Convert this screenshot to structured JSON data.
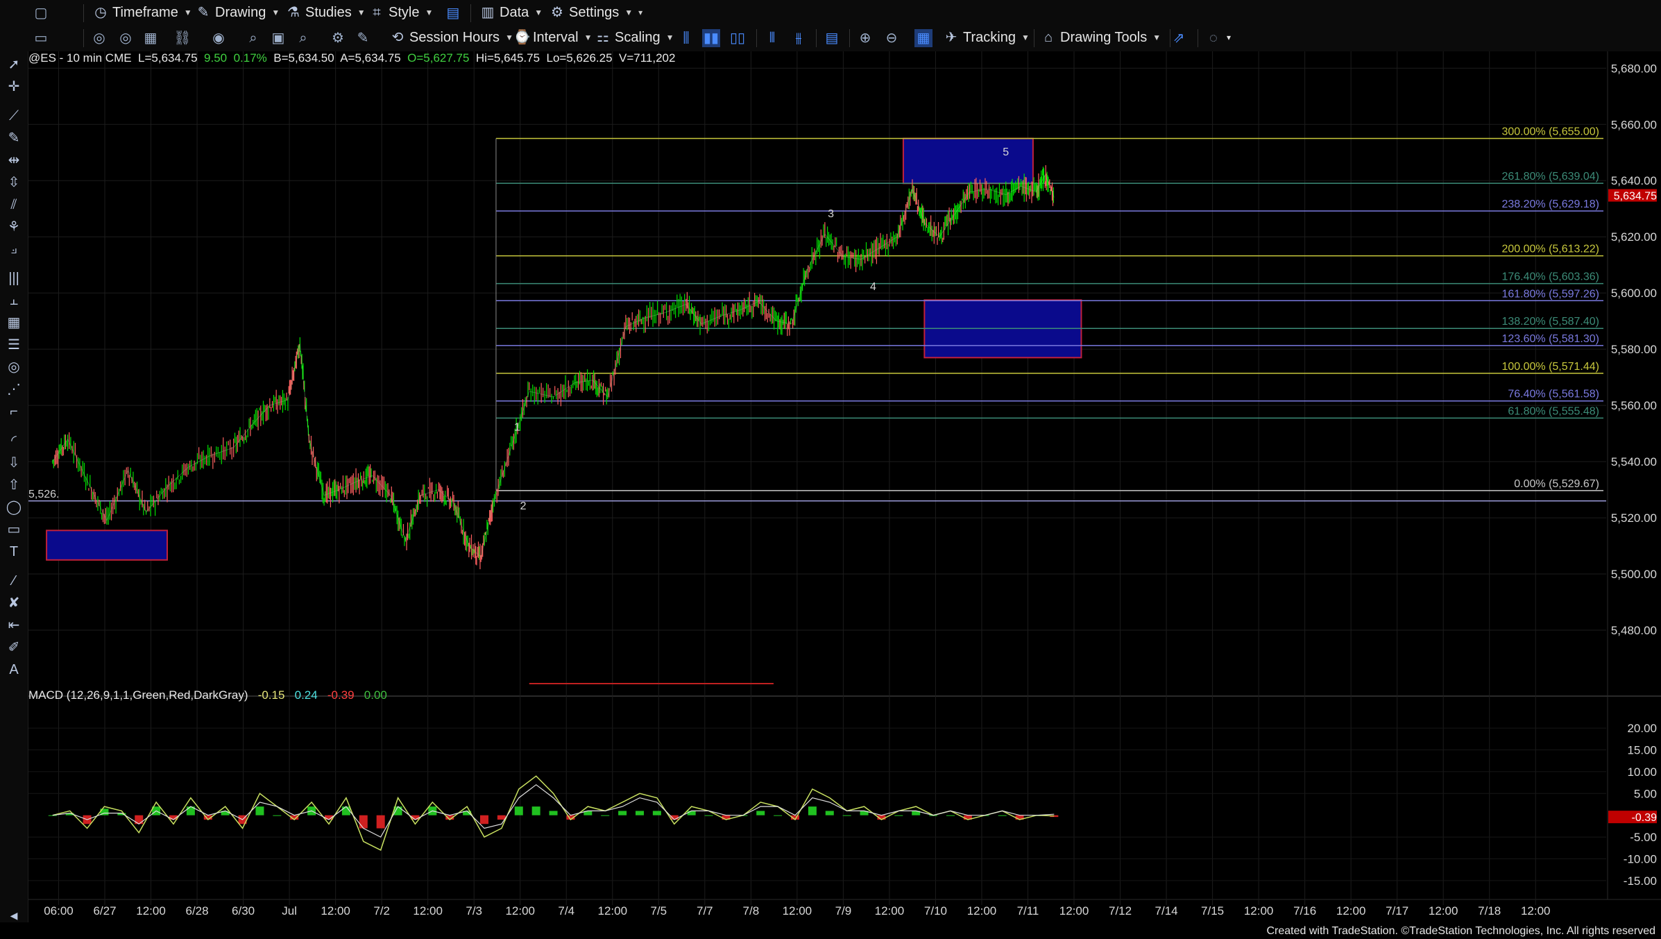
{
  "toolbar_top": {
    "items": [
      {
        "label": "Timeframe",
        "icon": "clock-icon"
      },
      {
        "label": "Drawing",
        "icon": "pen-icon"
      },
      {
        "label": "Studies",
        "icon": "flask-icon"
      },
      {
        "label": "Style",
        "icon": "style-icon"
      },
      {
        "label": "Data",
        "icon": "data-icon"
      },
      {
        "label": "Settings",
        "icon": "gear-icon"
      }
    ]
  },
  "toolbar_second": {
    "items": [
      {
        "label": "Session Hours",
        "icon": "session-icon"
      },
      {
        "label": "Interval",
        "icon": "interval-icon"
      },
      {
        "label": "Scaling",
        "icon": "scaling-icon"
      },
      {
        "label": "Tracking",
        "icon": "tracking-icon"
      },
      {
        "label": "Drawing Tools",
        "icon": "drawing-tools-icon"
      }
    ]
  },
  "symbol_header": {
    "symbol": "@ES - 10 min  CME",
    "last": "L=5,634.75",
    "change": "9.50",
    "pct": "0.17%",
    "bid": "B=5,634.50",
    "ask": "A=5,634.75",
    "open": "O=5,627.75",
    "high": "Hi=5,645.75",
    "low": "Lo=5,626.25",
    "volume": "V=711,202"
  },
  "macd_header": {
    "name": "MACD (12,26,9,1,1,Green,Red,DarkGray)",
    "v1": "-0.15",
    "v2": "0.24",
    "v3": "-0.39",
    "v4": "0.00"
  },
  "footer": "Created with TradeStation. ©TradeStation Technologies, Inc. All rights reserved",
  "colors": {
    "fib_yellow": "#c8c83c",
    "fib_teal": "#3c8c78",
    "fib_purple": "#7a7ae0",
    "box_fill": "#0a0a8c",
    "box_border": "#c0203c",
    "candle_up": "#00e000",
    "candle_down": "#ff6060",
    "macd_fast": "#c8e060",
    "macd_slow": "#e0e0e0",
    "last_price_tag": "#c00000"
  },
  "chart_data": [
    {
      "type": "line",
      "title": "@ES - 10 min  CME",
      "y_axis_ticks": [
        "5,680.00",
        "5,660.00",
        "5,640.00",
        "5,620.00",
        "5,600.00",
        "5,580.00",
        "5,560.00",
        "5,540.00",
        "5,520.00",
        "5,500.00",
        "5,480.00"
      ],
      "ylim": [
        5460,
        5686
      ],
      "x_axis_ticks": [
        "06:00",
        "6/27",
        "12:00",
        "6/28",
        "6/30",
        "Jul",
        "12:00",
        "7/2",
        "12:00",
        "7/3",
        "12:00",
        "7/4",
        "12:00",
        "7/5",
        "7/7",
        "7/8",
        "12:00",
        "7/9",
        "12:00",
        "7/10",
        "12:00",
        "7/11",
        "12:00",
        "7/12",
        "7/14",
        "7/15",
        "12:00",
        "7/16",
        "12:00",
        "7/17",
        "12:00",
        "7/18",
        "12:00"
      ],
      "last_price_label": "5,634.75",
      "last_price": 5634.75,
      "price_path": [
        {
          "t": 0.0,
          "p": 5540
        },
        {
          "t": 0.5,
          "p": 5548
        },
        {
          "t": 1.2,
          "p": 5532
        },
        {
          "t": 1.8,
          "p": 5519
        },
        {
          "t": 2.5,
          "p": 5537
        },
        {
          "t": 3.1,
          "p": 5522
        },
        {
          "t": 3.8,
          "p": 5531
        },
        {
          "t": 4.5,
          "p": 5538
        },
        {
          "t": 5.2,
          "p": 5542
        },
        {
          "t": 6.0,
          "p": 5545
        },
        {
          "t": 6.6,
          "p": 5553
        },
        {
          "t": 7.2,
          "p": 5560
        },
        {
          "t": 7.8,
          "p": 5562
        },
        {
          "t": 8.2,
          "p": 5582
        },
        {
          "t": 8.5,
          "p": 5548
        },
        {
          "t": 9.0,
          "p": 5528
        },
        {
          "t": 9.5,
          "p": 5530
        },
        {
          "t": 10.1,
          "p": 5533
        },
        {
          "t": 10.6,
          "p": 5535
        },
        {
          "t": 11.2,
          "p": 5528
        },
        {
          "t": 11.7,
          "p": 5512
        },
        {
          "t": 12.2,
          "p": 5528
        },
        {
          "t": 12.8,
          "p": 5530
        },
        {
          "t": 13.3,
          "p": 5525
        },
        {
          "t": 13.8,
          "p": 5510
        },
        {
          "t": 14.2,
          "p": 5506
        },
        {
          "t": 14.6,
          "p": 5525
        },
        {
          "t": 15.2,
          "p": 5545
        },
        {
          "t": 15.8,
          "p": 5565
        },
        {
          "t": 16.6,
          "p": 5563
        },
        {
          "t": 17.3,
          "p": 5568
        },
        {
          "t": 17.9,
          "p": 5569
        },
        {
          "t": 18.4,
          "p": 5563
        },
        {
          "t": 19.0,
          "p": 5588
        },
        {
          "t": 19.6,
          "p": 5591
        },
        {
          "t": 20.3,
          "p": 5593
        },
        {
          "t": 21.0,
          "p": 5596
        },
        {
          "t": 21.5,
          "p": 5589
        },
        {
          "t": 22.2,
          "p": 5592
        },
        {
          "t": 22.8,
          "p": 5594
        },
        {
          "t": 23.4,
          "p": 5597
        },
        {
          "t": 24.0,
          "p": 5590
        },
        {
          "t": 24.5,
          "p": 5589
        },
        {
          "t": 25.0,
          "p": 5608
        },
        {
          "t": 25.6,
          "p": 5621
        },
        {
          "t": 26.2,
          "p": 5613
        },
        {
          "t": 26.8,
          "p": 5612
        },
        {
          "t": 27.4,
          "p": 5616
        },
        {
          "t": 28.0,
          "p": 5620
        },
        {
          "t": 28.5,
          "p": 5637
        },
        {
          "t": 28.9,
          "p": 5625
        },
        {
          "t": 29.4,
          "p": 5620
        },
        {
          "t": 29.9,
          "p": 5628
        },
        {
          "t": 30.4,
          "p": 5636
        },
        {
          "t": 31.0,
          "p": 5637
        },
        {
          "t": 31.6,
          "p": 5635
        },
        {
          "t": 32.1,
          "p": 5638
        },
        {
          "t": 32.6,
          "p": 5636
        },
        {
          "t": 32.9,
          "p": 5642
        },
        {
          "t": 33.2,
          "p": 5634
        }
      ],
      "fib_levels": [
        {
          "label": "300.00% (5,655.00)",
          "price": 5655.0,
          "color": "#c8c83c"
        },
        {
          "label": "261.80% (5,639.04)",
          "price": 5639.04,
          "color": "#3c8c78"
        },
        {
          "label": "238.20% (5,629.18)",
          "price": 5629.18,
          "color": "#7a7ae0"
        },
        {
          "label": "200.00% (5,613.22)",
          "price": 5613.22,
          "color": "#c8c83c"
        },
        {
          "label": "176.40% (5,603.36)",
          "price": 5603.36,
          "color": "#3c8c78"
        },
        {
          "label": "161.80% (5,597.26)",
          "price": 5597.26,
          "color": "#7a7ae0"
        },
        {
          "label": "138.20% (5,587.40)",
          "price": 5587.4,
          "color": "#3c8c78"
        },
        {
          "label": "123.60% (5,581.30)",
          "price": 5581.3,
          "color": "#7a7ae0"
        },
        {
          "label": "100.00% (5,571.44)",
          "price": 5571.44,
          "color": "#c8c83c"
        },
        {
          "label": "76.40% (5,561.58)",
          "price": 5561.58,
          "color": "#7a7ae0"
        },
        {
          "label": "61.80% (5,555.48)",
          "price": 5555.48,
          "color": "#3c8c78"
        },
        {
          "label": "0.00% (5,529.67)",
          "price": 5529.67,
          "color": "#c8c8c8"
        }
      ],
      "horizontal_line": {
        "label": "5,526.",
        "price": 5526.0
      },
      "wave_labels": [
        {
          "label": "1",
          "t": 15.4,
          "p": 5551
        },
        {
          "label": "2",
          "t": 15.6,
          "p": 5523
        },
        {
          "label": "3",
          "t": 25.8,
          "p": 5627
        },
        {
          "label": "4",
          "t": 27.2,
          "p": 5601
        },
        {
          "label": "5",
          "t": 31.6,
          "p": 5649
        }
      ],
      "target_boxes": [
        {
          "t0": 28.2,
          "t1": 32.5,
          "p_top": 5655.0,
          "p_bottom": 5639.0
        },
        {
          "t0": 28.9,
          "t1": 34.1,
          "p_top": 5597.5,
          "p_bottom": 5577.0
        },
        {
          "t0": -0.2,
          "t1": 3.8,
          "p_top": 5515.5,
          "p_bottom": 5505.0
        }
      ]
    },
    {
      "type": "line",
      "title": "MACD (12,26,9,1,1,Green,Red,DarkGray)",
      "y_axis_ticks": [
        "20.00",
        "15.00",
        "10.00",
        "5.00",
        "-5.00",
        "-10.00",
        "-15.00"
      ],
      "ylim": [
        -19,
        24
      ],
      "last_value_label": "-0.39",
      "macd": [
        0,
        1,
        -3,
        2,
        1,
        -4,
        3,
        -2,
        4,
        -1,
        2,
        -3,
        5,
        2,
        -1,
        3,
        -2,
        4,
        -6,
        -8,
        4,
        -2,
        3,
        -1,
        2,
        -5,
        -3,
        6,
        9,
        5,
        -1,
        2,
        1,
        3,
        5,
        4,
        -2,
        2,
        1,
        -1,
        0,
        3,
        2,
        -1,
        6,
        4,
        1,
        2,
        -1,
        1,
        2,
        0,
        1,
        -1,
        0,
        1,
        -1,
        0,
        -0.15
      ],
      "signal": [
        0,
        0.5,
        -1,
        0.5,
        0.5,
        -2,
        1,
        -1,
        2,
        0,
        1,
        -1,
        3,
        2,
        0,
        1,
        -1,
        2,
        -3,
        -5,
        2,
        -1,
        1,
        0,
        1,
        -3,
        -2,
        4,
        7,
        4,
        0,
        1,
        1,
        2,
        4,
        3,
        -1,
        1,
        1,
        0,
        0,
        2,
        2,
        0,
        4,
        3,
        1,
        1,
        0,
        1,
        1,
        0,
        1,
        0,
        0,
        1,
        0,
        0,
        0.24
      ]
    }
  ]
}
